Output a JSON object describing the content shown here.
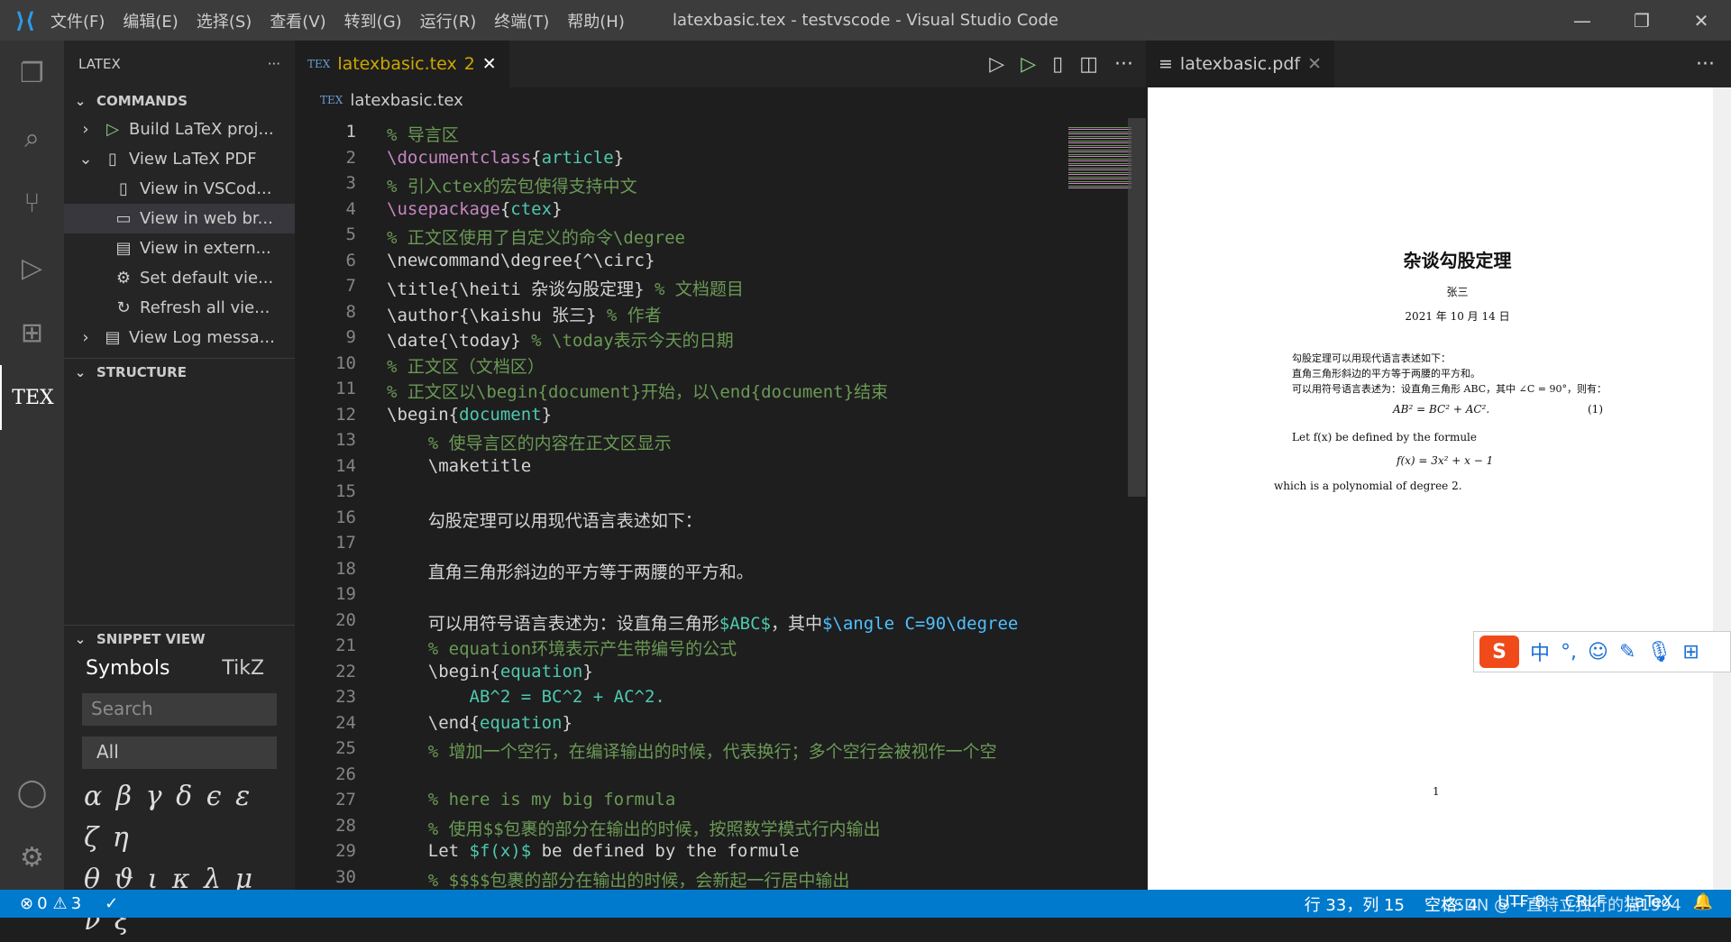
{
  "window": {
    "title": "latexbasic.tex - testvscode - Visual Studio Code",
    "menu": [
      "文件(F)",
      "编辑(E)",
      "选择(S)",
      "查看(V)",
      "转到(G)",
      "运行(R)",
      "终端(T)",
      "帮助(H)"
    ]
  },
  "sidebar": {
    "title": "LATEX",
    "commands_header": "COMMANDS",
    "items": [
      {
        "label": "Build LaTeX proj...",
        "icon": "play-icon",
        "chevron": "›"
      },
      {
        "label": "View LaTeX PDF",
        "icon": "pdf-icon",
        "chevron": "⌄"
      },
      {
        "label": "View in VSCod...",
        "icon": "pdf-icon"
      },
      {
        "label": "View in web br...",
        "icon": "browser-icon"
      },
      {
        "label": "View in extern...",
        "icon": "window-icon"
      },
      {
        "label": "Set default vie...",
        "icon": "gear-icon"
      },
      {
        "label": "Refresh all vie...",
        "icon": "refresh-icon"
      },
      {
        "label": "View Log messa...",
        "icon": "log-icon",
        "chevron": "›"
      }
    ],
    "structure_header": "STRUCTURE",
    "snippet_header": "SNIPPET VIEW",
    "snippet_tabs": [
      "Symbols",
      "TikZ"
    ],
    "search_placeholder": "Search",
    "filter": "All",
    "symbols_row1": "α β γ δ ϵ ε ζ η",
    "symbols_row2": "θ ϑ ι κ λ μ ν ξ"
  },
  "editor": {
    "tab_label": "latexbasic.tex",
    "tab_problems": "2",
    "breadcrumb": "latexbasic.tex",
    "lines": [
      [
        [
          "% 导言区",
          "c"
        ]
      ],
      [
        [
          "\\documentclass",
          "k"
        ],
        [
          "{",
          "t"
        ],
        [
          "article",
          "a"
        ],
        [
          "}",
          "t"
        ]
      ],
      [
        [
          "% 引入ctex的宏包使得支持中文",
          "c"
        ]
      ],
      [
        [
          "\\usepackage",
          "k"
        ],
        [
          "{",
          "t"
        ],
        [
          "ctex",
          "a"
        ],
        [
          "}",
          "t"
        ]
      ],
      [
        [
          "% 正文区使用了自定义的命令\\degree",
          "c"
        ]
      ],
      [
        [
          "\\newcommand\\degree{^\\circ}",
          "t"
        ]
      ],
      [
        [
          "\\title{\\heiti 杂谈勾股定理} ",
          "t"
        ],
        [
          "% 文档题目",
          "c"
        ]
      ],
      [
        [
          "\\author{\\kaishu 张三} ",
          "t"
        ],
        [
          "% 作者",
          "c"
        ]
      ],
      [
        [
          "\\date{\\today} ",
          "t"
        ],
        [
          "% \\today表示今天的日期",
          "c"
        ]
      ],
      [
        [
          "% 正文区（文档区）",
          "c"
        ]
      ],
      [
        [
          "% 正文区以\\begin{document}开始，以\\end{document}结束",
          "c"
        ]
      ],
      [
        [
          "\\begin{",
          "t"
        ],
        [
          "document",
          "a"
        ],
        [
          "}",
          "t"
        ]
      ],
      [
        [
          "    ",
          "t"
        ],
        [
          "% 使导言区的内容在正文区显示",
          "c"
        ]
      ],
      [
        [
          "    \\maketitle",
          "t"
        ]
      ],
      [
        [
          "",
          "t"
        ]
      ],
      [
        [
          "    勾股定理可以用现代语言表述如下：",
          "t"
        ]
      ],
      [
        [
          "",
          "t"
        ]
      ],
      [
        [
          "    直角三角形斜边的平方等于两腰的平方和。",
          "t"
        ]
      ],
      [
        [
          "",
          "t"
        ]
      ],
      [
        [
          "    可以用符号语言表述为：设直角三角形",
          "t"
        ],
        [
          "$ABC$",
          "a"
        ],
        [
          "，其中",
          "t"
        ],
        [
          "$\\angle C=90\\degree",
          "m"
        ]
      ],
      [
        [
          "    ",
          "t"
        ],
        [
          "% equation环境表示产生带编号的公式",
          "c"
        ]
      ],
      [
        [
          "    \\begin{",
          "t"
        ],
        [
          "equation",
          "a"
        ],
        [
          "}",
          "t"
        ]
      ],
      [
        [
          "        AB^2 = BC^2 + AC^2.",
          "a"
        ]
      ],
      [
        [
          "    \\end{",
          "t"
        ],
        [
          "equation",
          "a"
        ],
        [
          "}",
          "t"
        ]
      ],
      [
        [
          "    ",
          "t"
        ],
        [
          "% 增加一个空行，在编译输出的时候，代表换行；多个空行会被视作一个空",
          "c"
        ]
      ],
      [
        [
          "",
          "t"
        ]
      ],
      [
        [
          "    ",
          "t"
        ],
        [
          "% here is my big formula",
          "c"
        ]
      ],
      [
        [
          "    ",
          "t"
        ],
        [
          "% 使用$$包裹的部分在输出的时候，按照数学模式行内输出",
          "c"
        ]
      ],
      [
        [
          "    Let ",
          "t"
        ],
        [
          "$f(x)$",
          "a"
        ],
        [
          " be defined by the formule",
          "t"
        ]
      ],
      [
        [
          "    ",
          "t"
        ],
        [
          "% $$$$包裹的部分在输出的时候，会新起一行居中输出",
          "c"
        ]
      ]
    ]
  },
  "pdf": {
    "tab_label": "latexbasic.pdf",
    "title": "杂谈勾股定理",
    "author": "张三",
    "date": "2021 年 10 月 14 日",
    "para": [
      "勾股定理可以用现代语言表述如下：",
      "直角三角形斜边的平方等于两腰的平方和。",
      "可以用符号语言表述为：设直角三角形 ABC，其中 ∠C = 90°，则有："
    ],
    "eq1": "AB² = BC² + AC².",
    "eq1_num": "(1)",
    "let": "Let f(x) be defined by the formule",
    "eq2": "f(x) = 3x² + x − 1",
    "last": "which is a polynomial of degree 2.",
    "page": "1"
  },
  "ime": {
    "logo": "S",
    "mode": "中",
    "punct": "°,"
  },
  "status": {
    "errors": "0",
    "warnings": "3",
    "check": "✓",
    "position": "行 33，列 15",
    "indent": "空格: 4",
    "encoding": "UTF-8",
    "eol": "CRLF",
    "language": "LaTeX",
    "watermark": "CSDN @一直特立独行的猫1994"
  },
  "colors": {
    "statusbar": "#007acc",
    "activitybar": "#333333",
    "sidebar": "#252526",
    "editor": "#1e1e1e",
    "comment": "#6a9955",
    "keyword": "#c586c0"
  }
}
